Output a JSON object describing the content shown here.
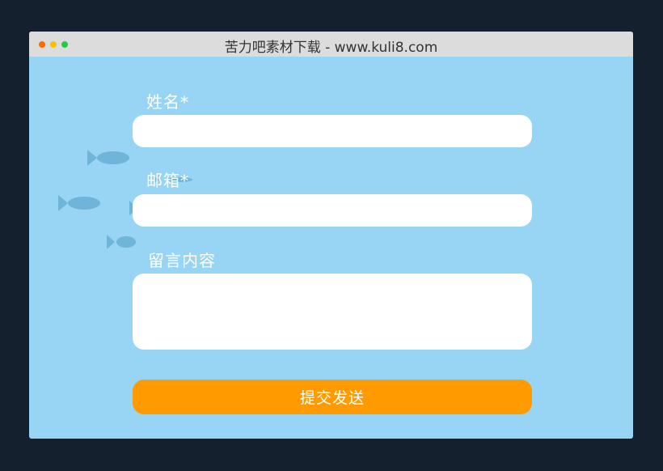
{
  "window": {
    "title": "苦力吧素材下载 - www.kuli8.com",
    "dot_colors": [
      "#ff6b00",
      "#f7c100",
      "#27c93f"
    ]
  },
  "form": {
    "name_label": "姓名*",
    "email_label": "邮箱*",
    "message_label": "留言内容",
    "name_value": "",
    "email_value": "",
    "message_value": "",
    "submit_label": "提交发送"
  },
  "decor": {
    "fish_icon": "fish-icon",
    "fish_color": "#6fb4d9"
  }
}
